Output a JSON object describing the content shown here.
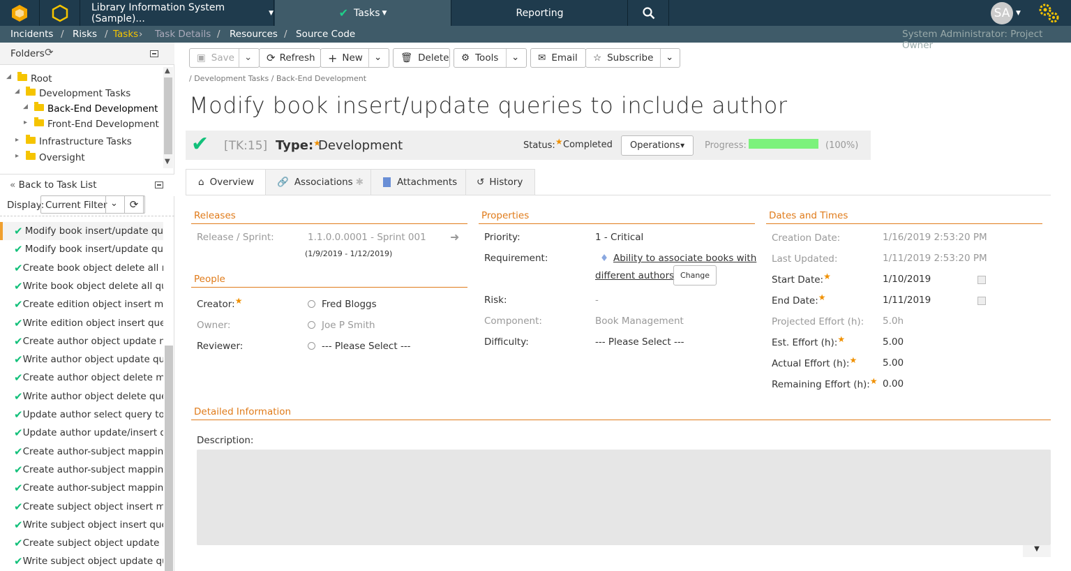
{
  "topbar": {
    "project": "Library Information System (Sample)...",
    "tasks_tab": "Tasks",
    "reporting_tab": "Reporting",
    "user_initials": "SA"
  },
  "subnav": {
    "items": [
      "Incidents",
      "Risks",
      "Tasks",
      "Task Details",
      "Resources",
      "Source Code"
    ],
    "user_role": "System Administrator: Project Owner"
  },
  "sidebar": {
    "folders_label": "Folders",
    "tree": [
      "Root",
      "Development Tasks",
      "Back-End Development",
      "Front-End Development",
      "Infrastructure Tasks",
      "Oversight"
    ],
    "back_label": "Back to Task List",
    "display_label": "Display:",
    "display_value": "Current Filter",
    "tasks": [
      "Modify book insert/update qu",
      "Modify book insert/update qu",
      "Create book object delete all r",
      "Write book object delete all qu",
      "Create edition object insert m",
      "Write edition object insert que",
      "Create author object update m",
      "Write author object update qu",
      "Create author object delete m",
      "Write author object delete que",
      "Update author select query to",
      "Update author update/insert q",
      "Create author-subject mappin",
      "Create author-subject mappin",
      "Create author-subject mappin",
      "Create subject object insert m",
      "Write subject object insert que",
      "Create subject object update r",
      "Write subject object update qu"
    ]
  },
  "toolbar": {
    "save": "Save",
    "refresh": "Refresh",
    "new": "New",
    "delete": "Delete",
    "tools": "Tools",
    "email": "Email",
    "subscribe": "Subscribe"
  },
  "breadcrumb": {
    "level1": "Development Tasks",
    "level2": "Back-End Development"
  },
  "task": {
    "title": "Modify book insert/update queries to include author",
    "id": "[TK:15]",
    "type_label": "Type:",
    "type_value": "Development",
    "status_label": "Status:",
    "status_value": "Completed",
    "operations": "Operations",
    "progress_label": "Progress:",
    "progress_value": 1.0,
    "progress_text": "(100%)"
  },
  "tabs": [
    "Overview",
    "Associations",
    "Attachments",
    "History"
  ],
  "releases": {
    "title": "Releases",
    "release_label": "Release / Sprint:",
    "release_value": "1.1.0.0.0001 - Sprint 001",
    "release_dates": "(1/9/2019 - 1/12/2019)"
  },
  "people": {
    "title": "People",
    "creator_label": "Creator:",
    "creator_value": "Fred Bloggs",
    "owner_label": "Owner:",
    "owner_value": "Joe P Smith",
    "reviewer_label": "Reviewer:",
    "reviewer_value": "--- Please Select ---"
  },
  "properties": {
    "title": "Properties",
    "priority_label": "Priority:",
    "priority_value": "1 - Critical",
    "requirement_label": "Requirement:",
    "requirement_line1": "Ability to associate books with",
    "requirement_line2": "different authors",
    "change_button": "Change",
    "risk_label": "Risk:",
    "risk_value": "-",
    "component_label": "Component:",
    "component_value": "Book Management",
    "difficulty_label": "Difficulty:",
    "difficulty_value": "--- Please Select ---"
  },
  "dates": {
    "title": "Dates and Times",
    "creation_label": "Creation Date:",
    "creation_value": "1/16/2019 2:53:20 PM",
    "updated_label": "Last Updated:",
    "updated_value": "1/11/2019 2:53:20 PM",
    "start_label": "Start Date:",
    "start_value": "1/10/2019",
    "end_label": "End Date:",
    "end_value": "1/11/2019",
    "projected_label": "Projected Effort (h):",
    "projected_value": "5.0h",
    "est_label": "Est. Effort (h):",
    "est_value": "5.00",
    "actual_label": "Actual Effort (h):",
    "actual_value": "5.00",
    "remaining_label": "Remaining Effort (h):",
    "remaining_value": "0.00"
  },
  "detail": {
    "title": "Detailed Information",
    "description_label": "Description:"
  },
  "colors": {
    "accent": "#e07b1a",
    "topbar": "#1f3b4d",
    "success": "#12c07a",
    "progress": "#7cf27c"
  }
}
